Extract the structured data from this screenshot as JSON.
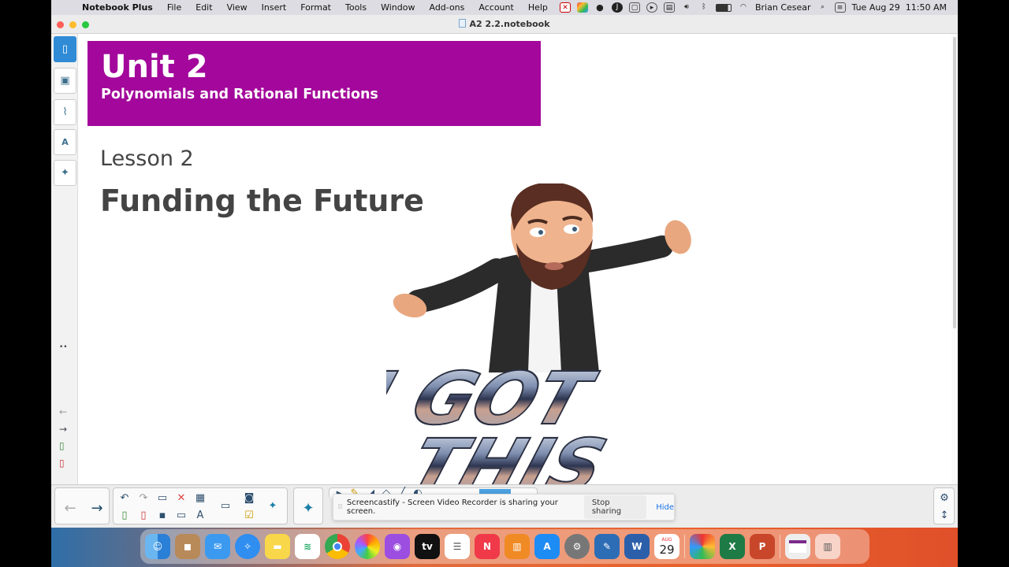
{
  "menubar": {
    "app_name": "Notebook Plus",
    "menus": [
      "File",
      "Edit",
      "View",
      "Insert",
      "Format",
      "Tools",
      "Window",
      "Add-ons",
      "Account",
      "Help"
    ],
    "user": "Brian Cesear",
    "datetime": "Tue Aug 29  11:50 AM"
  },
  "window": {
    "title": "A2 2.2.notebook"
  },
  "slide": {
    "unit": "Unit 2",
    "subtitle": "Polynomials and Rational Functions",
    "lesson": "Lesson 2",
    "lesson_title": "Funding the Future",
    "graphic_text_line1": "I GOT",
    "graphic_text_line2": "THIS"
  },
  "screencastify": {
    "message": "Screencastify - Screen Video Recorder is sharing your screen.",
    "stop_label": "Stop sharing",
    "hide_label": "Hide"
  },
  "dock": {
    "calendar_month": "AUG",
    "calendar_day": "29"
  },
  "colors": {
    "banner": "#a3079b",
    "accent": "#2f8bd6"
  }
}
